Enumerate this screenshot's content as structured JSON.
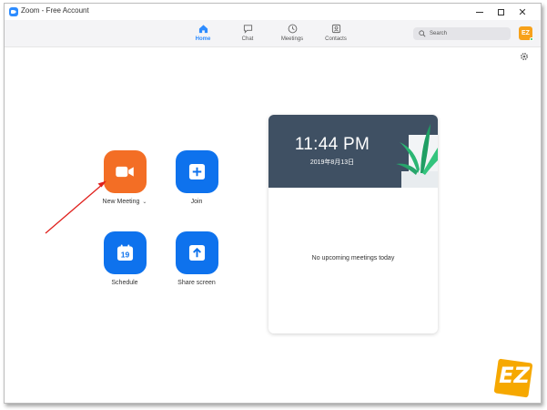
{
  "window": {
    "title": "Zoom - Free Account"
  },
  "nav": {
    "home": "Home",
    "chat": "Chat",
    "meetings": "Meetings",
    "contacts": "Contacts"
  },
  "search": {
    "placeholder": "Search"
  },
  "actions": {
    "new_meeting": "New Meeting",
    "join": "Join",
    "schedule": "Schedule",
    "schedule_day": "19",
    "share_screen": "Share screen"
  },
  "card": {
    "time": "11:44 PM",
    "date": "2019年8月13日",
    "empty_message": "No upcoming meetings today"
  },
  "watermark": "EZ",
  "colors": {
    "accent": "#2d8cff",
    "orange": "#f36e25",
    "blue": "#0e72ed"
  }
}
